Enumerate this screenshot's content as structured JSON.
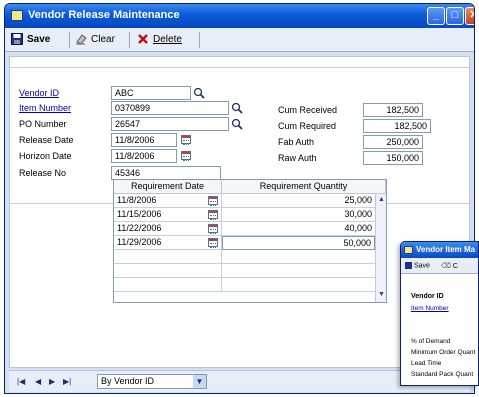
{
  "window": {
    "title": "Vendor Release Maintenance"
  },
  "toolbar": {
    "save_label": "Save",
    "clear_label": "Clear",
    "delete_label": "Delete"
  },
  "form": {
    "vendor_id": {
      "label": "Vendor ID",
      "value": "ABC"
    },
    "item_number": {
      "label": "Item Number",
      "value": "0370899"
    },
    "po_number": {
      "label": "PO Number",
      "value": "26547"
    },
    "release_date": {
      "label": "Release Date",
      "value": "11/8/2006"
    },
    "horizon_date": {
      "label": "Horizon Date",
      "value": "11/8/2006"
    },
    "release_no": {
      "label": "Release No",
      "value": "45346"
    },
    "cum_received": {
      "label": "Cum Received",
      "value": "182,500"
    },
    "cum_required": {
      "label": "Cum Required",
      "value": "182,500"
    },
    "fab_auth": {
      "label": "Fab Auth",
      "value": "250,000"
    },
    "raw_auth": {
      "label": "Raw Auth",
      "value": "150,000"
    }
  },
  "grid": {
    "headers": [
      "Requirement Date",
      "Requirement Quantity"
    ],
    "rows": [
      {
        "date": "11/8/2006",
        "qty": "25,000"
      },
      {
        "date": "11/15/2006",
        "qty": "30,000"
      },
      {
        "date": "11/22/2006",
        "qty": "40,000"
      },
      {
        "date": "11/29/2006",
        "qty": "50,000"
      }
    ]
  },
  "status": {
    "sort_by": "By Vendor ID"
  },
  "second_window": {
    "title": "Vendor Item Ma",
    "save_label": "Save",
    "clear_label": "C",
    "vendor_id_label": "Vendor ID",
    "item_number_label": "Item Number",
    "pct_demand_label": "% of Demand",
    "min_order_label": "Minimum Order Quant",
    "lead_time_label": "Lead Time",
    "std_pack_label": "Standard Pack Quant"
  }
}
